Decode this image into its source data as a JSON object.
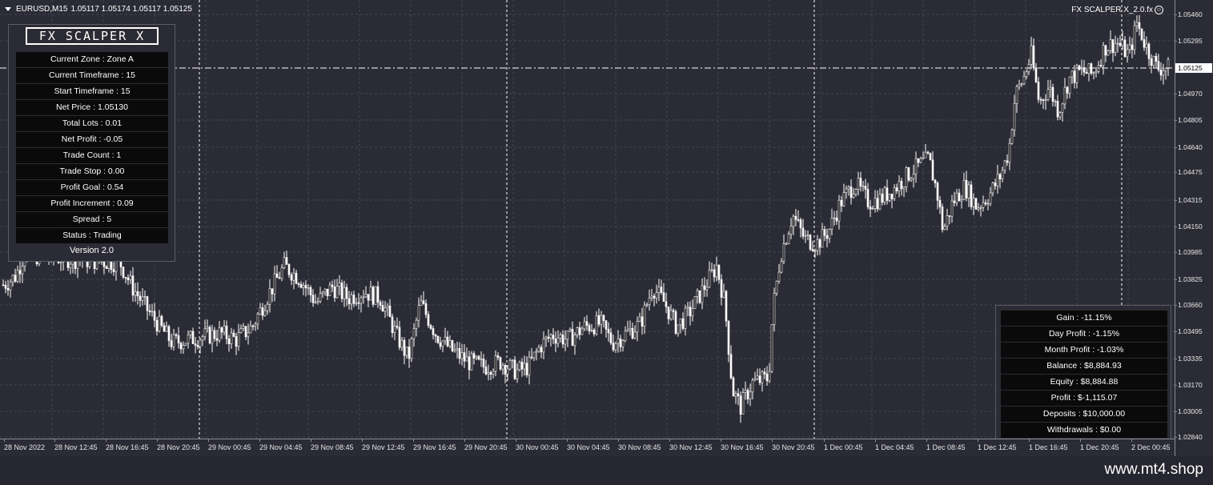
{
  "header": {
    "symbol": "EURUSD,M15",
    "ohlc": "1.05117 1.05174 1.05117 1.05125",
    "ea_name": "FX SCALPER X_2.0.fx"
  },
  "price_axis": {
    "ticks": [
      "1.05460",
      "1.05295",
      "1.04970",
      "1.04805",
      "1.04640",
      "1.04475",
      "1.04315",
      "1.04150",
      "1.03985",
      "1.03825",
      "1.03660",
      "1.03495",
      "1.03335",
      "1.03170",
      "1.03005",
      "1.02840"
    ],
    "current_price": "1.05125"
  },
  "time_axis": {
    "ticks": [
      "28 Nov 2022",
      "28 Nov 12:45",
      "28 Nov 16:45",
      "28 Nov 20:45",
      "29 Nov 00:45",
      "29 Nov 04:45",
      "29 Nov 08:45",
      "29 Nov 12:45",
      "29 Nov 16:45",
      "29 Nov 20:45",
      "30 Nov 00:45",
      "30 Nov 04:45",
      "30 Nov 08:45",
      "30 Nov 12:45",
      "30 Nov 16:45",
      "30 Nov 20:45",
      "1 Dec 00:45",
      "1 Dec 04:45",
      "1 Dec 08:45",
      "1 Dec 12:45",
      "1 Dec 16:45",
      "1 Dec 20:45",
      "2 Dec 00:45"
    ]
  },
  "info_panel": {
    "logo": "FX SCALPER X",
    "rows": [
      "Current Zone : Zone A",
      "Current Timeframe : 15",
      "Start Timeframe : 15",
      "Net Price : 1.05130",
      "Total Lots : 0.01",
      "Net Profit : -0.05",
      "Trade Count : 1",
      "Trade Stop : 0.00",
      "Profit Goal : 0.54",
      "Profit Increment : 0.09",
      "Spread : 5",
      "Status : Trading"
    ],
    "version": "Version 2.0"
  },
  "stats_panel": {
    "rows": [
      "Gain : -11.15%",
      "Day Profit : -1.15%",
      "Month Profit : -1.03%",
      "Balance : $8,884.93",
      "Equity : $8,884.88",
      "Profit : $-1,115.07",
      "Deposits : $10,000.00",
      "Withdrawals : $0.00"
    ]
  },
  "watermark": "www.mt4.shop",
  "colors": {
    "background": "#2b2b35",
    "candles": "#ffffff",
    "grid": "#45454f",
    "panel_row": "#0a0a0a"
  },
  "chart_data": {
    "type": "candlestick",
    "symbol": "EURUSD",
    "timeframe": "M15",
    "ylim": [
      1.028,
      1.0552
    ],
    "price_path": [
      [
        0,
        1.0375
      ],
      [
        10,
        1.0378
      ],
      [
        20,
        1.0382
      ],
      [
        30,
        1.0395
      ],
      [
        150,
        1.039
      ],
      [
        165,
        1.0375
      ],
      [
        185,
        1.036
      ],
      [
        200,
        1.035
      ],
      [
        215,
        1.034
      ],
      [
        235,
        1.0342
      ],
      [
        255,
        1.0344
      ],
      [
        275,
        1.0346
      ],
      [
        295,
        1.0342
      ],
      [
        315,
        1.035
      ],
      [
        335,
        1.037
      ],
      [
        355,
        1.0388
      ],
      [
        375,
        1.038
      ],
      [
        395,
        1.0365
      ],
      [
        415,
        1.0375
      ],
      [
        435,
        1.0368
      ],
      [
        455,
        1.0372
      ],
      [
        475,
        1.0368
      ],
      [
        495,
        1.0345
      ],
      [
        510,
        1.033
      ],
      [
        525,
        1.0365
      ],
      [
        545,
        1.0345
      ],
      [
        565,
        1.0335
      ],
      [
        585,
        1.0328
      ],
      [
        605,
        1.0325
      ],
      [
        625,
        1.0328
      ],
      [
        645,
        1.0322
      ],
      [
        660,
        1.0325
      ],
      [
        675,
        1.0338
      ],
      [
        690,
        1.0345
      ],
      [
        710,
        1.0342
      ],
      [
        730,
        1.035
      ],
      [
        750,
        1.0352
      ],
      [
        765,
        1.034
      ],
      [
        780,
        1.0345
      ],
      [
        800,
        1.0352
      ],
      [
        815,
        1.0375
      ],
      [
        830,
        1.0365
      ],
      [
        845,
        1.035
      ],
      [
        860,
        1.0358
      ],
      [
        880,
        1.0375
      ],
      [
        895,
        1.0388
      ],
      [
        905,
        1.0365
      ],
      [
        915,
        1.031
      ],
      [
        925,
        1.03
      ],
      [
        940,
        1.0315
      ],
      [
        960,
        1.0318
      ],
      [
        965,
        1.036
      ],
      [
        975,
        1.0395
      ],
      [
        990,
        1.042
      ],
      [
        1005,
        1.0405
      ],
      [
        1020,
        1.0402
      ],
      [
        1035,
        1.041
      ],
      [
        1050,
        1.0428
      ],
      [
        1068,
        1.044
      ],
      [
        1085,
        1.0428
      ],
      [
        1100,
        1.043
      ],
      [
        1120,
        1.0438
      ],
      [
        1140,
        1.0448
      ],
      [
        1160,
        1.0455
      ],
      [
        1170,
        1.0435
      ],
      [
        1178,
        1.041
      ],
      [
        1190,
        1.0428
      ],
      [
        1205,
        1.0438
      ],
      [
        1220,
        1.0425
      ],
      [
        1235,
        1.0432
      ],
      [
        1250,
        1.0445
      ],
      [
        1260,
        1.046
      ],
      [
        1268,
        1.0495
      ],
      [
        1278,
        1.0505
      ],
      [
        1288,
        1.052
      ],
      [
        1298,
        1.049
      ],
      [
        1310,
        1.05
      ],
      [
        1322,
        1.0485
      ],
      [
        1335,
        1.0505
      ],
      [
        1350,
        1.051
      ],
      [
        1365,
        1.0508
      ],
      [
        1380,
        1.0525
      ],
      [
        1395,
        1.0528
      ],
      [
        1410,
        1.052
      ],
      [
        1420,
        1.054
      ],
      [
        1432,
        1.0525
      ],
      [
        1445,
        1.0512
      ],
      [
        1460,
        1.0512
      ]
    ]
  }
}
